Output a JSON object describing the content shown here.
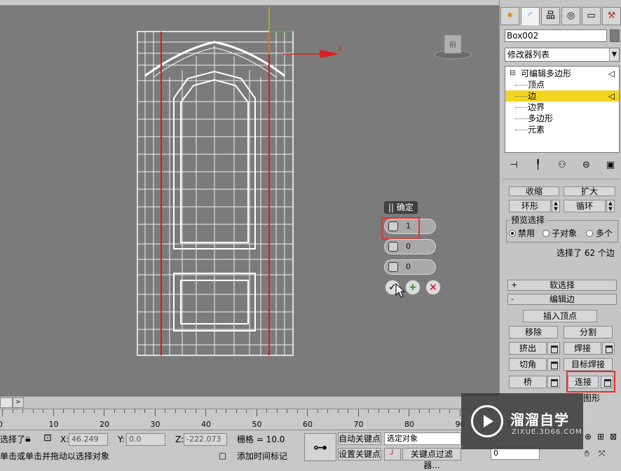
{
  "viewport": {
    "axis_label": "x",
    "viewcube_label": "前"
  },
  "caddy": {
    "title": "|| 确定",
    "segments_value": "1",
    "pinch_value": "0",
    "slide_value": "0"
  },
  "command_panel": {
    "object_name": "Box002",
    "modifier_list": "修改器列表",
    "stack": {
      "root": "可编辑多边形",
      "items": [
        "顶点",
        "边",
        "边界",
        "多边形",
        "元素"
      ]
    },
    "selection": {
      "shrink": "收缩",
      "grow": "扩大",
      "ring": "环形",
      "loop": "循环",
      "preview_title": "预览选择",
      "opt_disable": "禁用",
      "opt_subobject": "子对象",
      "opt_multi": "多个",
      "status": "选择了 62 个边"
    },
    "soft_selection": {
      "sign": "+",
      "title": "软选择"
    },
    "edit_edges": {
      "sign": "-",
      "title": "编辑边",
      "insert_vertex": "插入顶点",
      "remove": "移除",
      "split": "分割",
      "extrude": "挤出",
      "weld": "焊接",
      "chamfer": "切角",
      "target_weld": "目标焊接",
      "bridge": "桥",
      "connect": "连接",
      "create_shape": "图形"
    }
  },
  "timeline": {
    "next_label": ">",
    "ticks": [
      "0",
      "10",
      "20",
      "30",
      "40",
      "50",
      "60",
      "70",
      "80",
      "90",
      "10"
    ]
  },
  "status": {
    "selected_label": "选择了",
    "x_label": "X:",
    "x_value": "46.249",
    "y_label": "Y:",
    "y_value": "0.0",
    "z_label": "Z:",
    "z_value": "-222.073",
    "grid": "栅格 = 10.0",
    "auto_key": "自动关键点",
    "set_key": "设置关键点",
    "selected_objects": "选定对象",
    "key_filters": "关键点过滤器...",
    "prompt": "单击或单击并拖动以选择对象",
    "add_time_tag": "添加时间标记",
    "frame_value": "0"
  },
  "watermark": {
    "brand": "溜溜自学",
    "url": "ZIXUE.3D66.COM"
  }
}
